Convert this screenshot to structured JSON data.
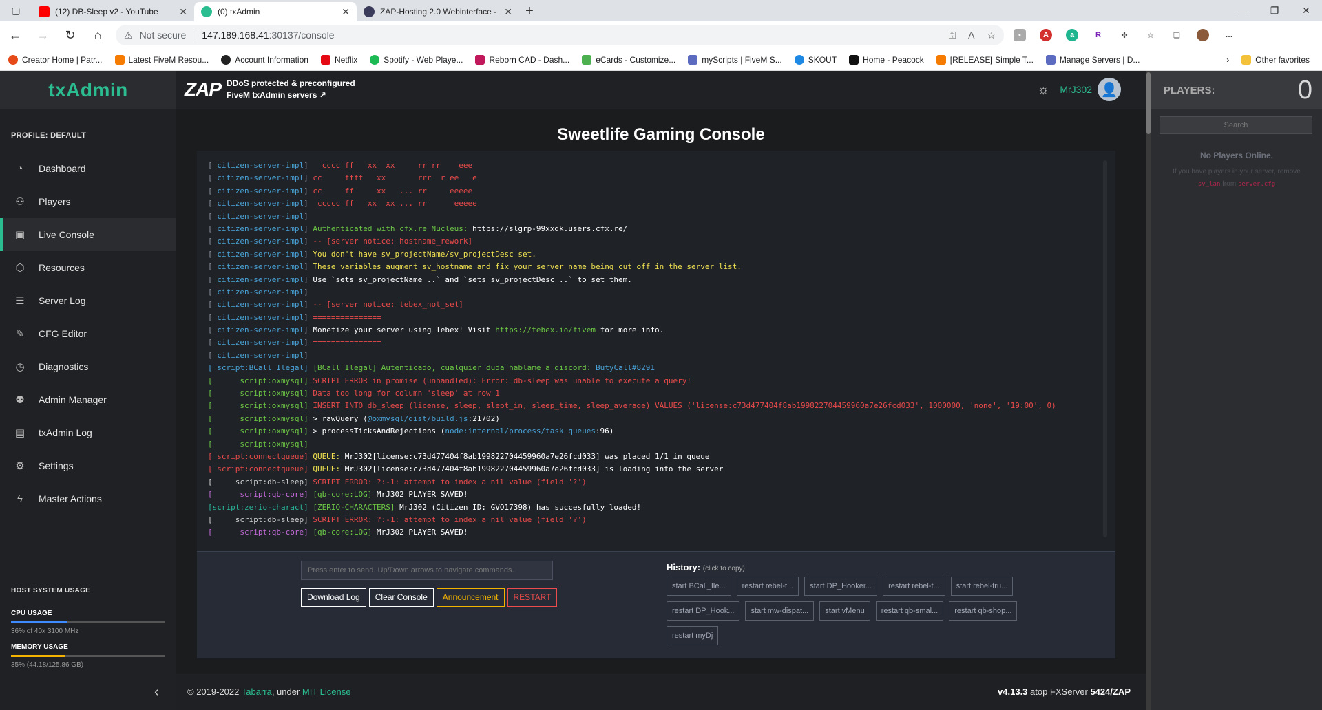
{
  "browser": {
    "tabs": [
      {
        "title": "(12) DB-Sleep v2 - YouTube",
        "color": "#ff0000"
      },
      {
        "title": "(0) txAdmin",
        "color": "#2bbd8f"
      },
      {
        "title": "ZAP-Hosting 2.0 Webinterface -",
        "color": "#3a3a5a"
      }
    ],
    "url_prefix": "Not secure",
    "url_host": "147.189.168.41",
    "url_path": ":30137/console",
    "bookmarks": [
      "Creator Home | Patr...",
      "Latest FiveM Resou...",
      "Account Information",
      "Netflix",
      "Spotify - Web Playe...",
      "Reborn CAD - Dash...",
      "eCards - Customize...",
      "myScripts | FiveM S...",
      "SKOUT",
      "Home - Peacock",
      "[RELEASE] Simple T...",
      "Manage Servers | D..."
    ],
    "other_favorites": "Other favorites"
  },
  "sidebar": {
    "logo": "txAdmin",
    "profile": "PROFILE: DEFAULT",
    "items": [
      {
        "label": "Dashboard",
        "icon": "dashboard-icon",
        "glyph": "◔"
      },
      {
        "label": "Players",
        "icon": "players-icon",
        "glyph": "⚇"
      },
      {
        "label": "Live Console",
        "icon": "console-icon",
        "glyph": "▣"
      },
      {
        "label": "Resources",
        "icon": "resources-icon",
        "glyph": "⬡"
      },
      {
        "label": "Server Log",
        "icon": "serverlog-icon",
        "glyph": "☰"
      },
      {
        "label": "CFG Editor",
        "icon": "pencil-icon",
        "glyph": "✎"
      },
      {
        "label": "Diagnostics",
        "icon": "diagnostics-icon",
        "glyph": "◷"
      },
      {
        "label": "Admin Manager",
        "icon": "admin-icon",
        "glyph": "⚉"
      },
      {
        "label": "txAdmin Log",
        "icon": "log-icon",
        "glyph": "▤"
      },
      {
        "label": "Settings",
        "icon": "gear-icon",
        "glyph": "⚙"
      },
      {
        "label": "Master Actions",
        "icon": "bolt-icon",
        "glyph": "ϟ"
      }
    ],
    "host_usage_title": "HOST SYSTEM USAGE",
    "cpu_label": "CPU USAGE",
    "cpu_text": "36% of 40x 3100 MHz",
    "cpu_percent": 36,
    "mem_label": "MEMORY USAGE",
    "mem_text": "35% (44.18/125.86 GB)",
    "mem_percent": 35
  },
  "header": {
    "zap_logo": "ZAP",
    "zap_line1": "DDoS protected & preconfigured",
    "zap_line2": "FiveM txAdmin servers ↗",
    "username": "MrJ302"
  },
  "console": {
    "title": "Sweetlife Gaming Console",
    "lines": [
      [
        {
          "t": "[ ",
          "c": "#8a8f9a"
        },
        {
          "t": "citizen-server-impl",
          "c": "#4aa3d8"
        },
        {
          "t": "]   ",
          "c": "#8a8f9a"
        },
        {
          "t": "cccc ff   xx  xx     rr rr    eee",
          "c": "#e84a4a"
        }
      ],
      [
        {
          "t": "[ ",
          "c": "#8a8f9a"
        },
        {
          "t": "citizen-server-impl",
          "c": "#4aa3d8"
        },
        {
          "t": "] ",
          "c": "#8a8f9a"
        },
        {
          "t": "cc     ffff   xx       rrr  r ee   e",
          "c": "#e84a4a"
        }
      ],
      [
        {
          "t": "[ ",
          "c": "#8a8f9a"
        },
        {
          "t": "citizen-server-impl",
          "c": "#4aa3d8"
        },
        {
          "t": "] ",
          "c": "#8a8f9a"
        },
        {
          "t": "cc     ff     xx   ... rr     eeeee",
          "c": "#e84a4a"
        }
      ],
      [
        {
          "t": "[ ",
          "c": "#8a8f9a"
        },
        {
          "t": "citizen-server-impl",
          "c": "#4aa3d8"
        },
        {
          "t": "]  ",
          "c": "#8a8f9a"
        },
        {
          "t": "ccccc ff   xx  xx ... rr      eeeee",
          "c": "#e84a4a"
        }
      ],
      [
        {
          "t": "[ ",
          "c": "#8a8f9a"
        },
        {
          "t": "citizen-server-impl",
          "c": "#4aa3d8"
        },
        {
          "t": "]",
          "c": "#8a8f9a"
        }
      ],
      [
        {
          "t": "[ ",
          "c": "#8a8f9a"
        },
        {
          "t": "citizen-server-impl",
          "c": "#4aa3d8"
        },
        {
          "t": "] ",
          "c": "#8a8f9a"
        },
        {
          "t": "Authenticated with cfx.re Nucleus: ",
          "c": "#6cc644"
        },
        {
          "t": "https://slgrp-99xxdk.users.cfx.re/",
          "c": "#ffffff"
        }
      ],
      [
        {
          "t": "[ ",
          "c": "#8a8f9a"
        },
        {
          "t": "citizen-server-impl",
          "c": "#4aa3d8"
        },
        {
          "t": "] ",
          "c": "#8a8f9a"
        },
        {
          "t": "-- [server notice: hostname_rework]",
          "c": "#e84a4a"
        }
      ],
      [
        {
          "t": "[ ",
          "c": "#8a8f9a"
        },
        {
          "t": "citizen-server-impl",
          "c": "#4aa3d8"
        },
        {
          "t": "] ",
          "c": "#8a8f9a"
        },
        {
          "t": "You don't have sv_projectName/sv_projectDesc set.",
          "c": "#f0e050"
        }
      ],
      [
        {
          "t": "[ ",
          "c": "#8a8f9a"
        },
        {
          "t": "citizen-server-impl",
          "c": "#4aa3d8"
        },
        {
          "t": "] ",
          "c": "#8a8f9a"
        },
        {
          "t": "These variables augment sv_hostname and fix your server name being cut off in the server list.",
          "c": "#f0e050"
        }
      ],
      [
        {
          "t": "[ ",
          "c": "#8a8f9a"
        },
        {
          "t": "citizen-server-impl",
          "c": "#4aa3d8"
        },
        {
          "t": "] ",
          "c": "#8a8f9a"
        },
        {
          "t": "Use `sets sv_projectName ..` and `sets sv_projectDesc ..` to set them.",
          "c": "#ffffff"
        }
      ],
      [
        {
          "t": "[ ",
          "c": "#8a8f9a"
        },
        {
          "t": "citizen-server-impl",
          "c": "#4aa3d8"
        },
        {
          "t": "]",
          "c": "#8a8f9a"
        }
      ],
      [
        {
          "t": "[ ",
          "c": "#8a8f9a"
        },
        {
          "t": "citizen-server-impl",
          "c": "#4aa3d8"
        },
        {
          "t": "] ",
          "c": "#8a8f9a"
        },
        {
          "t": "-- [server notice: tebex_not_set]",
          "c": "#e84a4a"
        }
      ],
      [
        {
          "t": "[ ",
          "c": "#8a8f9a"
        },
        {
          "t": "citizen-server-impl",
          "c": "#4aa3d8"
        },
        {
          "t": "] ",
          "c": "#8a8f9a"
        },
        {
          "t": "===============",
          "c": "#e84a4a"
        }
      ],
      [
        {
          "t": "[ ",
          "c": "#8a8f9a"
        },
        {
          "t": "citizen-server-impl",
          "c": "#4aa3d8"
        },
        {
          "t": "] ",
          "c": "#8a8f9a"
        },
        {
          "t": "Monetize your server using Tebex! Visit ",
          "c": "#ffffff"
        },
        {
          "t": "https://tebex.io/fivem",
          "c": "#6cc644"
        },
        {
          "t": " for more info.",
          "c": "#ffffff"
        }
      ],
      [
        {
          "t": "[ ",
          "c": "#8a8f9a"
        },
        {
          "t": "citizen-server-impl",
          "c": "#4aa3d8"
        },
        {
          "t": "] ",
          "c": "#8a8f9a"
        },
        {
          "t": "===============",
          "c": "#e84a4a"
        }
      ],
      [
        {
          "t": "[ ",
          "c": "#8a8f9a"
        },
        {
          "t": "citizen-server-impl",
          "c": "#4aa3d8"
        },
        {
          "t": "]",
          "c": "#8a8f9a"
        }
      ],
      [
        {
          "t": "[ ",
          "c": "#4aa3d8"
        },
        {
          "t": "script:BCall_Ilegal",
          "c": "#4aa3d8"
        },
        {
          "t": "] ",
          "c": "#4aa3d8"
        },
        {
          "t": "[BCall_Ilegal] Autenticado, cualquier duda hablame a discord: ",
          "c": "#6cc644"
        },
        {
          "t": "ButyCall#8291",
          "c": "#4aa3d8"
        }
      ],
      [
        {
          "t": "[      ",
          "c": "#6cc644"
        },
        {
          "t": "script:oxmysql",
          "c": "#6cc644"
        },
        {
          "t": "] ",
          "c": "#6cc644"
        },
        {
          "t": "SCRIPT ERROR in promise (unhandled): Error: db-sleep was unable to execute a query!",
          "c": "#e84a4a"
        }
      ],
      [
        {
          "t": "[      ",
          "c": "#6cc644"
        },
        {
          "t": "script:oxmysql",
          "c": "#6cc644"
        },
        {
          "t": "] ",
          "c": "#6cc644"
        },
        {
          "t": "Data too long for column 'sleep' at row 1",
          "c": "#e84a4a"
        }
      ],
      [
        {
          "t": "[      ",
          "c": "#6cc644"
        },
        {
          "t": "script:oxmysql",
          "c": "#6cc644"
        },
        {
          "t": "] ",
          "c": "#6cc644"
        },
        {
          "t": "INSERT INTO db_sleep (license, sleep, slept_in, sleep_time, sleep_average) VALUES ('license:c73d477404f8ab199822704459960a7e26fcd033', 1000000, 'none', '19:00', 0)",
          "c": "#e84a4a"
        }
      ],
      [
        {
          "t": "[      ",
          "c": "#6cc644"
        },
        {
          "t": "script:oxmysql",
          "c": "#6cc644"
        },
        {
          "t": "] ",
          "c": "#6cc644"
        },
        {
          "t": "> rawQuery (",
          "c": "#ffffff"
        },
        {
          "t": "@oxmysql/dist/build.js",
          "c": "#4aa3d8"
        },
        {
          "t": ":21702)",
          "c": "#ffffff"
        }
      ],
      [
        {
          "t": "[      ",
          "c": "#6cc644"
        },
        {
          "t": "script:oxmysql",
          "c": "#6cc644"
        },
        {
          "t": "] ",
          "c": "#6cc644"
        },
        {
          "t": "> processTicksAndRejections (",
          "c": "#ffffff"
        },
        {
          "t": "node:internal/process/task_queues",
          "c": "#4aa3d8"
        },
        {
          "t": ":96)",
          "c": "#ffffff"
        }
      ],
      [
        {
          "t": "[      ",
          "c": "#6cc644"
        },
        {
          "t": "script:oxmysql",
          "c": "#6cc644"
        },
        {
          "t": "]",
          "c": "#6cc644"
        }
      ],
      [
        {
          "t": "[ ",
          "c": "#e84a4a"
        },
        {
          "t": "script:connectqueue",
          "c": "#e84a4a"
        },
        {
          "t": "] ",
          "c": "#e84a4a"
        },
        {
          "t": "QUEUE: ",
          "c": "#f0e050"
        },
        {
          "t": "MrJ302[license:c73d477404f8ab199822704459960a7e26fcd033] was placed 1/1 in queue",
          "c": "#ffffff"
        }
      ],
      [
        {
          "t": "[ ",
          "c": "#e84a4a"
        },
        {
          "t": "script:connectqueue",
          "c": "#e84a4a"
        },
        {
          "t": "] ",
          "c": "#e84a4a"
        },
        {
          "t": "QUEUE: ",
          "c": "#f0e050"
        },
        {
          "t": "MrJ302[license:c73d477404f8ab199822704459960a7e26fcd033] is loading into the server",
          "c": "#ffffff"
        }
      ],
      [
        {
          "t": "[     ",
          "c": "#cfcfcf"
        },
        {
          "t": "script:db-sleep",
          "c": "#cfcfcf"
        },
        {
          "t": "] ",
          "c": "#cfcfcf"
        },
        {
          "t": "SCRIPT ERROR: ?:-1: attempt to index a nil value (field '?')",
          "c": "#e84a4a"
        }
      ],
      [
        {
          "t": "[      ",
          "c": "#c46ad8"
        },
        {
          "t": "script:qb-core",
          "c": "#c46ad8"
        },
        {
          "t": "] ",
          "c": "#c46ad8"
        },
        {
          "t": "[qb-core:LOG] ",
          "c": "#6cc644"
        },
        {
          "t": "MrJ302 PLAYER SAVED!",
          "c": "#ffffff"
        }
      ],
      [
        {
          "t": "[",
          "c": "#2ab59a"
        },
        {
          "t": "script:zerio-charact",
          "c": "#2ab59a"
        },
        {
          "t": "] ",
          "c": "#2ab59a"
        },
        {
          "t": "[ZERIO-CHARACTERS] ",
          "c": "#6cc644"
        },
        {
          "t": "MrJ302 (Citizen ID: GVO17398) has succesfully loaded!",
          "c": "#ffffff"
        }
      ],
      [
        {
          "t": "[     ",
          "c": "#cfcfcf"
        },
        {
          "t": "script:db-sleep",
          "c": "#cfcfcf"
        },
        {
          "t": "] ",
          "c": "#cfcfcf"
        },
        {
          "t": "SCRIPT ERROR: ?:-1: attempt to index a nil value (field '?')",
          "c": "#e84a4a"
        }
      ],
      [
        {
          "t": "[      ",
          "c": "#c46ad8"
        },
        {
          "t": "script:qb-core",
          "c": "#c46ad8"
        },
        {
          "t": "] ",
          "c": "#c46ad8"
        },
        {
          "t": "[qb-core:LOG] ",
          "c": "#6cc644"
        },
        {
          "t": "MrJ302 PLAYER SAVED!",
          "c": "#ffffff"
        }
      ]
    ],
    "input_placeholder": "Press enter to send. Up/Down arrows to navigate commands.",
    "buttons": {
      "download": "Download Log",
      "clear": "Clear Console",
      "announce": "Announcement",
      "restart": "RESTART"
    },
    "history_title": "History:",
    "history_hint": "(click to copy)",
    "history": [
      "start BCall_Ile...",
      "restart rebel-t...",
      "start DP_Hooker...",
      "restart rebel-t...",
      "start rebel-tru...",
      "restart DP_Hook...",
      "start mw-dispat...",
      "start vMenu",
      "restart qb-smal...",
      "restart qb-shop...",
      "restart myDj"
    ]
  },
  "footer": {
    "copyright": "© 2019-2022 ",
    "author": "Tabarra",
    "under": ", under ",
    "license": "MIT License",
    "version": "v4.13.3",
    "atop": " atop FXServer ",
    "fx": "5424/ZAP"
  },
  "players": {
    "title": "PLAYERS:",
    "count": "0",
    "search_placeholder": "Search",
    "empty": "No Players Online.",
    "hint_1": "If you have players in your server, remove",
    "hint_code1": "sv_lan",
    "hint_from": " from ",
    "hint_code2": "server.cfg"
  }
}
